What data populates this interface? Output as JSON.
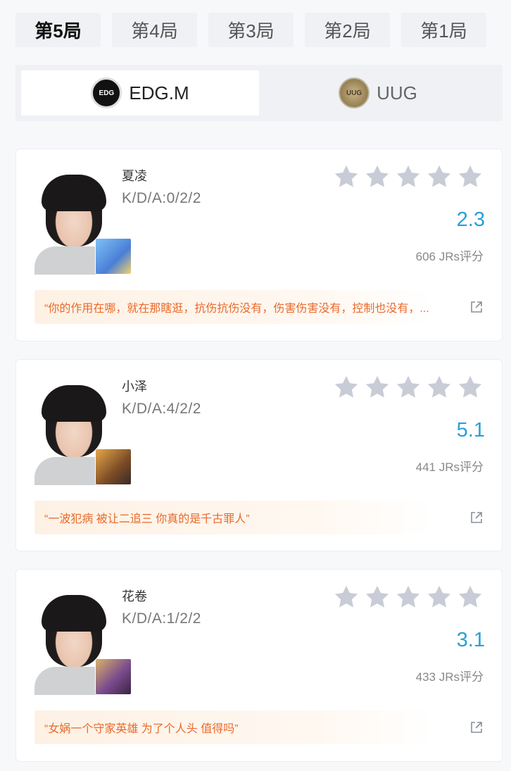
{
  "tabs": [
    {
      "label": "第5局",
      "active": true
    },
    {
      "label": "第4局",
      "active": false
    },
    {
      "label": "第3局",
      "active": false
    },
    {
      "label": "第2局",
      "active": false
    },
    {
      "label": "第1局",
      "active": false
    }
  ],
  "teams": {
    "left": {
      "name": "EDG.M",
      "logo_text": "EDG",
      "active": true
    },
    "right": {
      "name": "UUG",
      "logo_text": "UUG",
      "active": false
    }
  },
  "players": [
    {
      "name": "夏凌",
      "kda": "K/D/A:0/2/2",
      "stars_filled": 0,
      "score": "2.3",
      "jrs": "606 JRs评分",
      "comment": "“你的作用在哪，就在那瞎逛，抗伤抗伤没有，伤害伤害没有，控制也没有，...",
      "hero_color": "#5aa0e8"
    },
    {
      "name": "小泽",
      "kda": "K/D/A:4/2/2",
      "stars_filled": 0,
      "score": "5.1",
      "jrs": "441 JRs评分",
      "comment": "“一波犯病 被让二追三 你真的是千古罪人”",
      "hero_color": "#c58a3a"
    },
    {
      "name": "花卷",
      "kda": "K/D/A:1/2/2",
      "stars_filled": 0,
      "score": "3.1",
      "jrs": "433 JRs评分",
      "comment": "“女娲一个守家英雄 为了个人头 值得吗”",
      "hero_color": "#8a5b9c"
    }
  ],
  "colors": {
    "accent": "#2a9fd8",
    "comment": "#e96a2c",
    "star_empty": "#c8ccd6"
  }
}
